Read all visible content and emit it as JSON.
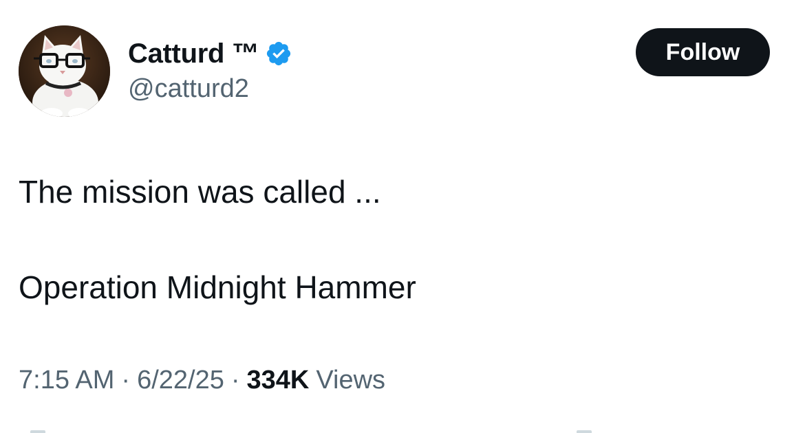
{
  "author": {
    "display_name": "Catturd ™",
    "handle": "@catturd2",
    "verified": true,
    "verified_color": "#1d9bf0",
    "avatar_icon": "cat-with-glasses-avatar"
  },
  "follow_button": {
    "label": "Follow",
    "bg_color": "#0f1419",
    "text_color": "#ffffff"
  },
  "tweet": {
    "lines": [
      "The mission was called ...",
      "Operation Midnight Hammer"
    ]
  },
  "meta": {
    "time": "7:15 AM",
    "separator": "·",
    "date": "6/22/25",
    "views_count": "334K",
    "views_label": "Views"
  },
  "colors": {
    "text_primary": "#0f1419",
    "text_secondary": "#536471",
    "background": "#ffffff"
  }
}
